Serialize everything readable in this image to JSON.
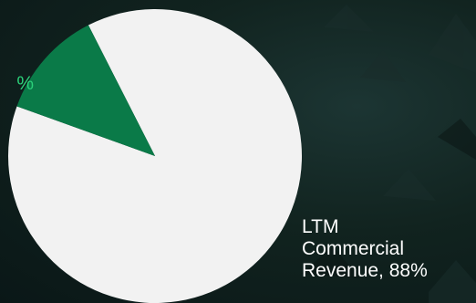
{
  "chart_data": {
    "type": "pie",
    "slices": [
      {
        "label": "LTM Commercial Revenue",
        "value": 88,
        "label_text": "LTM\nCommercial\nRevenue, 88%",
        "color": "#f2f2f2"
      },
      {
        "label": "",
        "value": 12,
        "label_text": "%",
        "color": "#0a7a48"
      }
    ],
    "label_colors": {
      "commercial": "#ffffff",
      "other": "#2bd17a"
    },
    "background_color": "#0d1e1d"
  }
}
